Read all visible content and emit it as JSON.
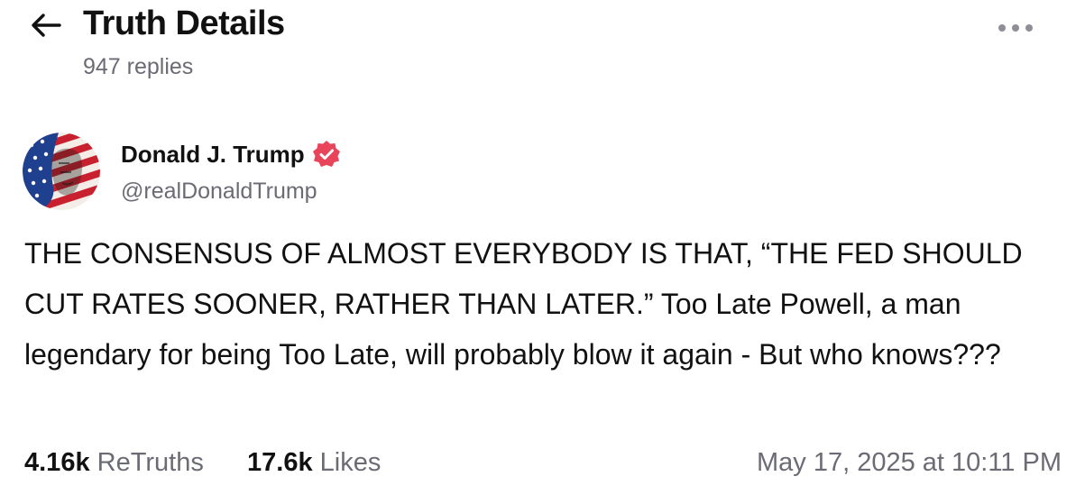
{
  "header": {
    "title": "Truth Details",
    "replies": "947 replies"
  },
  "post": {
    "author_name": "Donald J. Trump",
    "handle": "@realDonaldTrump",
    "text": "THE CONSENSUS OF ALMOST EVERYBODY IS THAT, “THE FED SHOULD CUT RATES SOONER, RATHER THAN LATER.” Too Late Powell, a man legendary for being Too Late, will probably blow it again - But who knows???",
    "retruths_count": "4.16k",
    "retruths_label": "ReTruths",
    "likes_count": "17.6k",
    "likes_label": "Likes",
    "timestamp": "May 17, 2025 at 10:11 PM"
  },
  "icons": {
    "back": "arrow-left-icon",
    "more": "more-horizontal-icon",
    "verified": "verified-badge-icon"
  },
  "colors": {
    "verified_badge": "#e8445a",
    "secondary_text": "#6b6b75"
  }
}
